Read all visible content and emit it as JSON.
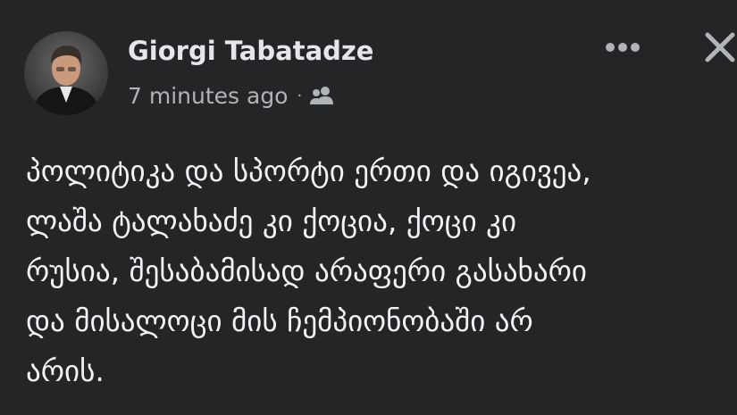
{
  "post": {
    "author_name": "Giorgi Tabatadze",
    "timestamp": "7 minutes ago",
    "separator": "·",
    "audience_icon": "friends-icon",
    "more_icon": "more-horizontal-icon",
    "close_icon": "close-icon",
    "text": "პოლიტიკა და სპორტი ერთი და იგივეა,\nლაშა ტალახაძე კი ქოცია, ქოცი კი\nრუსია, შესაბამისად არაფერი გასახარი\nდა მისალოცი მის ჩემპიონობაში არ\nარის."
  },
  "colors": {
    "background": "#242526",
    "primary_text": "#e4e6eb",
    "secondary_text": "#b0b3b8"
  }
}
